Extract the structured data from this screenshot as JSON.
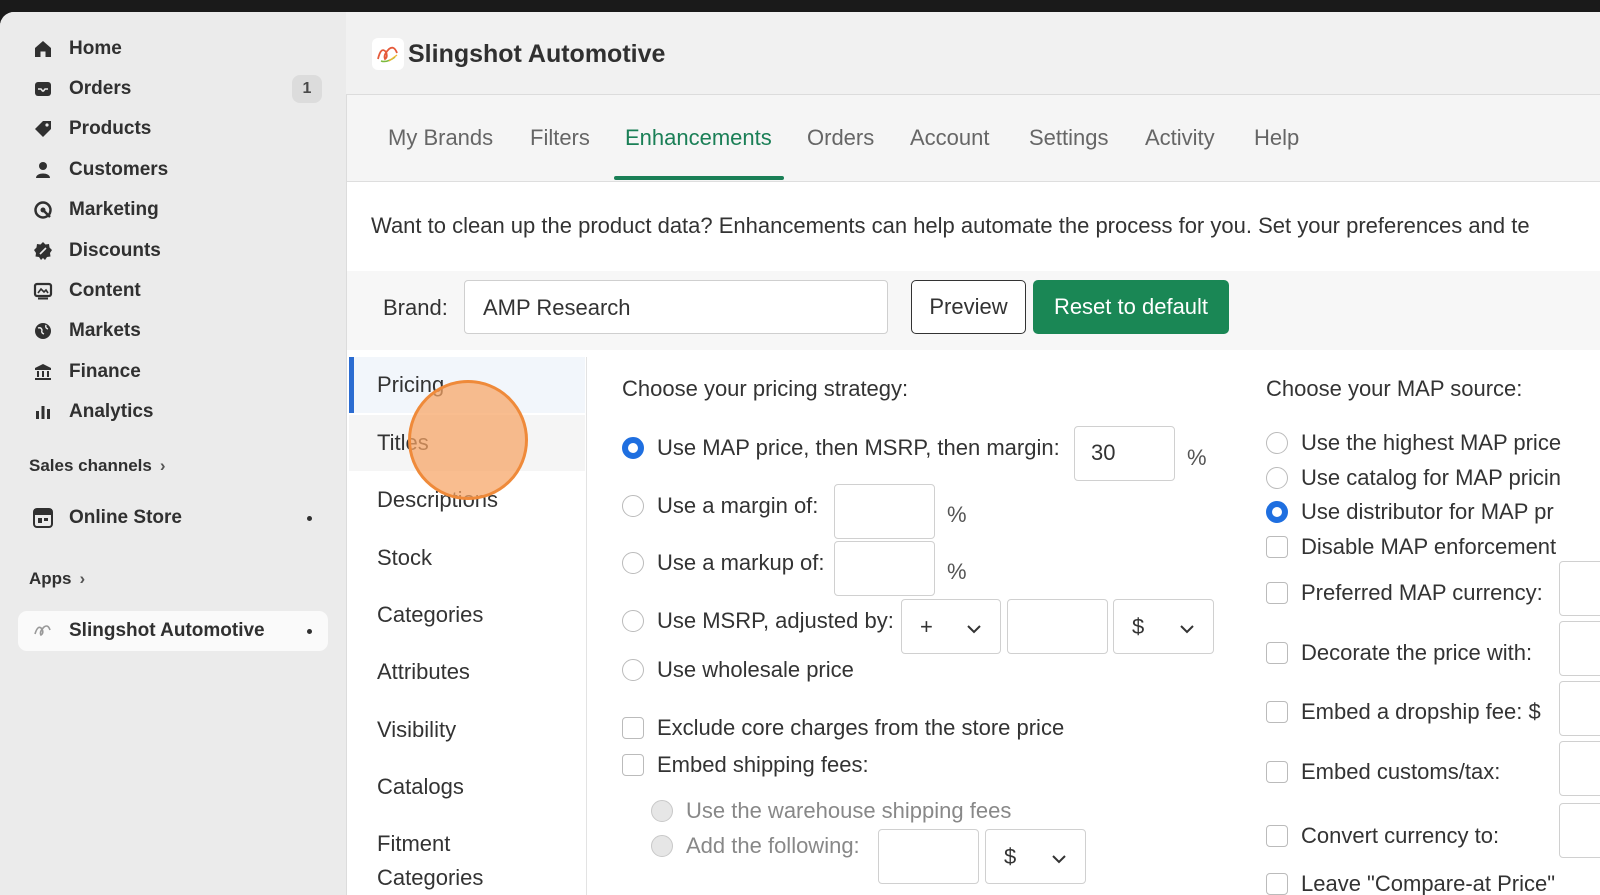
{
  "sidebar": {
    "items": [
      {
        "label": "Home",
        "icon": "home-icon"
      },
      {
        "label": "Orders",
        "icon": "orders-icon",
        "badge": "1"
      },
      {
        "label": "Products",
        "icon": "tag-icon"
      },
      {
        "label": "Customers",
        "icon": "person-icon"
      },
      {
        "label": "Marketing",
        "icon": "target-icon"
      },
      {
        "label": "Discounts",
        "icon": "discount-icon"
      },
      {
        "label": "Content",
        "icon": "content-icon"
      },
      {
        "label": "Markets",
        "icon": "globe-icon"
      },
      {
        "label": "Finance",
        "icon": "bank-icon"
      },
      {
        "label": "Analytics",
        "icon": "bar-chart-icon"
      }
    ],
    "sales_channels_label": "Sales channels",
    "online_store_label": "Online Store",
    "apps_label": "Apps",
    "app_item_label": "Slingshot Automotive"
  },
  "app": {
    "title": "Slingshot Automotive"
  },
  "tabs": [
    "My Brands",
    "Filters",
    "Enhancements",
    "Orders",
    "Account",
    "Settings",
    "Activity",
    "Help"
  ],
  "active_tab": "Enhancements",
  "intro_text": "Want to clean up the product data? Enhancements can help automate the process for you. Set your preferences and te",
  "brand": {
    "label": "Brand:",
    "value": "AMP Research",
    "preview_label": "Preview",
    "reset_label": "Reset to default"
  },
  "subnav": [
    "Pricing",
    "Titles",
    "Descriptions",
    "Stock",
    "Categories",
    "Attributes",
    "Visibility",
    "Catalogs",
    "Fitment Categories"
  ],
  "pricing": {
    "heading": "Choose your pricing strategy:",
    "opt_map": "Use MAP price, then MSRP, then margin:",
    "opt_map_value": "30",
    "opt_margin": "Use a margin of:",
    "opt_markup": "Use a markup of:",
    "opt_msrp": "Use MSRP, adjusted by:",
    "msrp_sign": "+",
    "msrp_unit": "$",
    "opt_wholesale": "Use wholesale price",
    "exclude_core": "Exclude core charges from the store price",
    "embed_shipping": "Embed shipping fees:",
    "warehouse_fees": "Use the warehouse shipping fees",
    "add_following": "Add the following:",
    "add_unit": "$",
    "percent": "%"
  },
  "map": {
    "heading": "Choose your MAP source:",
    "opt_highest": "Use the highest MAP price",
    "opt_catalog": "Use catalog for MAP pricin",
    "opt_distributor": "Use distributor for MAP pr",
    "disable": "Disable MAP enforcement",
    "currency": "Preferred MAP currency:",
    "decorate": "Decorate the price with:",
    "dropship": "Embed a dropship fee: $",
    "customs": "Embed customs/tax:",
    "convert": "Convert currency to:",
    "compare_at": "Leave \"Compare-at Price\""
  }
}
